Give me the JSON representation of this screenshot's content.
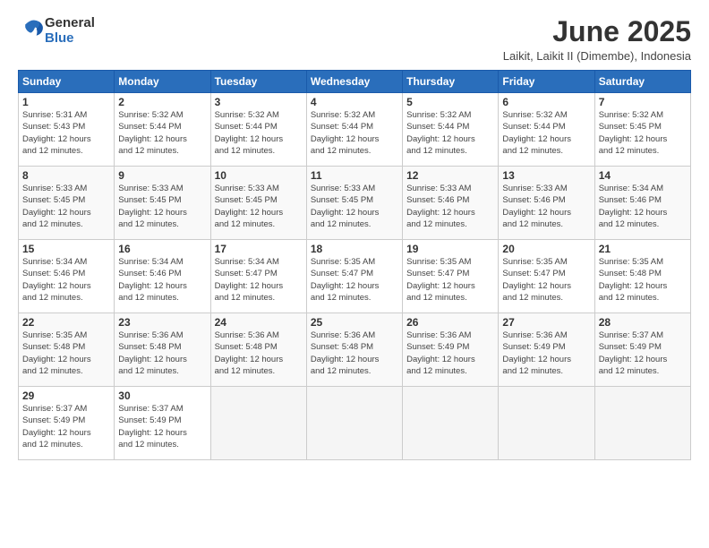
{
  "logo": {
    "general": "General",
    "blue": "Blue"
  },
  "title": "June 2025",
  "subtitle": "Laikit, Laikit II (Dimembe), Indonesia",
  "days_header": [
    "Sunday",
    "Monday",
    "Tuesday",
    "Wednesday",
    "Thursday",
    "Friday",
    "Saturday"
  ],
  "weeks": [
    [
      {
        "day": "1",
        "sunrise": "5:31 AM",
        "sunset": "5:43 PM",
        "daylight": "12 hours and 12 minutes."
      },
      {
        "day": "2",
        "sunrise": "5:32 AM",
        "sunset": "5:44 PM",
        "daylight": "12 hours and 12 minutes."
      },
      {
        "day": "3",
        "sunrise": "5:32 AM",
        "sunset": "5:44 PM",
        "daylight": "12 hours and 12 minutes."
      },
      {
        "day": "4",
        "sunrise": "5:32 AM",
        "sunset": "5:44 PM",
        "daylight": "12 hours and 12 minutes."
      },
      {
        "day": "5",
        "sunrise": "5:32 AM",
        "sunset": "5:44 PM",
        "daylight": "12 hours and 12 minutes."
      },
      {
        "day": "6",
        "sunrise": "5:32 AM",
        "sunset": "5:44 PM",
        "daylight": "12 hours and 12 minutes."
      },
      {
        "day": "7",
        "sunrise": "5:32 AM",
        "sunset": "5:45 PM",
        "daylight": "12 hours and 12 minutes."
      }
    ],
    [
      {
        "day": "8",
        "sunrise": "5:33 AM",
        "sunset": "5:45 PM",
        "daylight": "12 hours and 12 minutes."
      },
      {
        "day": "9",
        "sunrise": "5:33 AM",
        "sunset": "5:45 PM",
        "daylight": "12 hours and 12 minutes."
      },
      {
        "day": "10",
        "sunrise": "5:33 AM",
        "sunset": "5:45 PM",
        "daylight": "12 hours and 12 minutes."
      },
      {
        "day": "11",
        "sunrise": "5:33 AM",
        "sunset": "5:45 PM",
        "daylight": "12 hours and 12 minutes."
      },
      {
        "day": "12",
        "sunrise": "5:33 AM",
        "sunset": "5:46 PM",
        "daylight": "12 hours and 12 minutes."
      },
      {
        "day": "13",
        "sunrise": "5:33 AM",
        "sunset": "5:46 PM",
        "daylight": "12 hours and 12 minutes."
      },
      {
        "day": "14",
        "sunrise": "5:34 AM",
        "sunset": "5:46 PM",
        "daylight": "12 hours and 12 minutes."
      }
    ],
    [
      {
        "day": "15",
        "sunrise": "5:34 AM",
        "sunset": "5:46 PM",
        "daylight": "12 hours and 12 minutes."
      },
      {
        "day": "16",
        "sunrise": "5:34 AM",
        "sunset": "5:46 PM",
        "daylight": "12 hours and 12 minutes."
      },
      {
        "day": "17",
        "sunrise": "5:34 AM",
        "sunset": "5:47 PM",
        "daylight": "12 hours and 12 minutes."
      },
      {
        "day": "18",
        "sunrise": "5:35 AM",
        "sunset": "5:47 PM",
        "daylight": "12 hours and 12 minutes."
      },
      {
        "day": "19",
        "sunrise": "5:35 AM",
        "sunset": "5:47 PM",
        "daylight": "12 hours and 12 minutes."
      },
      {
        "day": "20",
        "sunrise": "5:35 AM",
        "sunset": "5:47 PM",
        "daylight": "12 hours and 12 minutes."
      },
      {
        "day": "21",
        "sunrise": "5:35 AM",
        "sunset": "5:48 PM",
        "daylight": "12 hours and 12 minutes."
      }
    ],
    [
      {
        "day": "22",
        "sunrise": "5:35 AM",
        "sunset": "5:48 PM",
        "daylight": "12 hours and 12 minutes."
      },
      {
        "day": "23",
        "sunrise": "5:36 AM",
        "sunset": "5:48 PM",
        "daylight": "12 hours and 12 minutes."
      },
      {
        "day": "24",
        "sunrise": "5:36 AM",
        "sunset": "5:48 PM",
        "daylight": "12 hours and 12 minutes."
      },
      {
        "day": "25",
        "sunrise": "5:36 AM",
        "sunset": "5:48 PM",
        "daylight": "12 hours and 12 minutes."
      },
      {
        "day": "26",
        "sunrise": "5:36 AM",
        "sunset": "5:49 PM",
        "daylight": "12 hours and 12 minutes."
      },
      {
        "day": "27",
        "sunrise": "5:36 AM",
        "sunset": "5:49 PM",
        "daylight": "12 hours and 12 minutes."
      },
      {
        "day": "28",
        "sunrise": "5:37 AM",
        "sunset": "5:49 PM",
        "daylight": "12 hours and 12 minutes."
      }
    ],
    [
      {
        "day": "29",
        "sunrise": "5:37 AM",
        "sunset": "5:49 PM",
        "daylight": "12 hours and 12 minutes."
      },
      {
        "day": "30",
        "sunrise": "5:37 AM",
        "sunset": "5:49 PM",
        "daylight": "12 hours and 12 minutes."
      },
      null,
      null,
      null,
      null,
      null
    ]
  ],
  "labels": {
    "sunrise": "Sunrise:",
    "sunset": "Sunset:",
    "daylight": "Daylight:"
  }
}
